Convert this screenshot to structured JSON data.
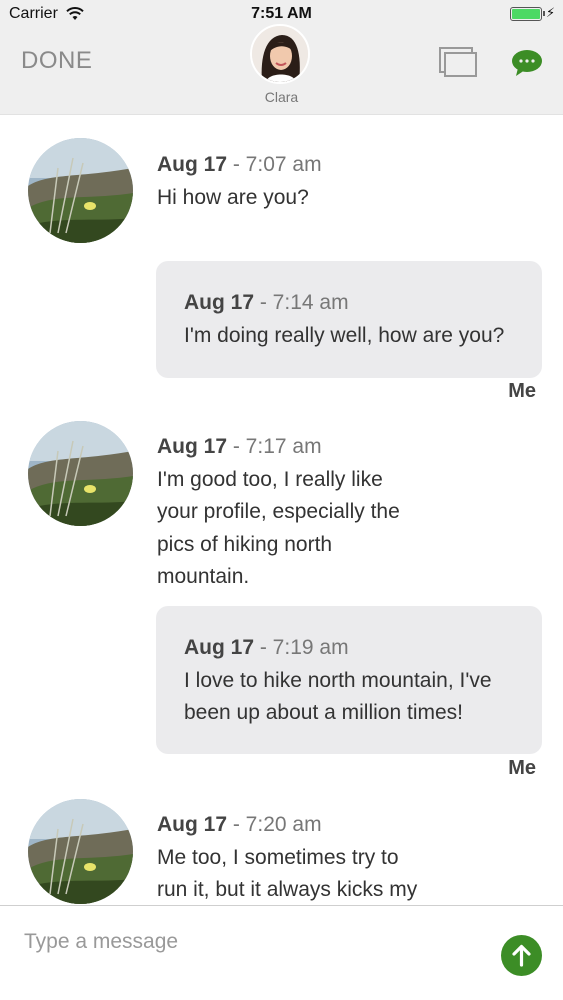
{
  "status_bar": {
    "carrier": "Carrier",
    "time": "7:51 AM",
    "battery_level": 1.0
  },
  "nav": {
    "done_label": "DONE",
    "contact_name": "Clara",
    "icons": [
      "windows-icon",
      "chat-bubble-icon"
    ],
    "accent_color": "#3c8d26"
  },
  "messages": [
    {
      "sender": "them",
      "date": "Aug 17",
      "time": "- 7:07 am",
      "text": "Hi how are you?"
    },
    {
      "sender": "me",
      "date": "Aug 17",
      "time": "- 7:14 am",
      "text": "I'm doing really well, how are you?",
      "sender_label": "Me"
    },
    {
      "sender": "them",
      "date": "Aug 17",
      "time": "- 7:17 am",
      "text_lines": [
        "I'm good too, I really like",
        "your profile, especially the",
        "pics of hiking north",
        "mountain."
      ]
    },
    {
      "sender": "me",
      "date": "Aug 17",
      "time": "- 7:19 am",
      "text_lines": [
        "I love to hike north mountain, I've",
        "been up about a million times!"
      ],
      "sender_label": "Me"
    },
    {
      "sender": "them",
      "date": "Aug 17",
      "time": "- 7:20 am",
      "text_lines": [
        "Me too, I sometimes try to",
        "run it, but it always kicks my"
      ]
    }
  ],
  "composer": {
    "placeholder": "Type a message",
    "value": ""
  }
}
